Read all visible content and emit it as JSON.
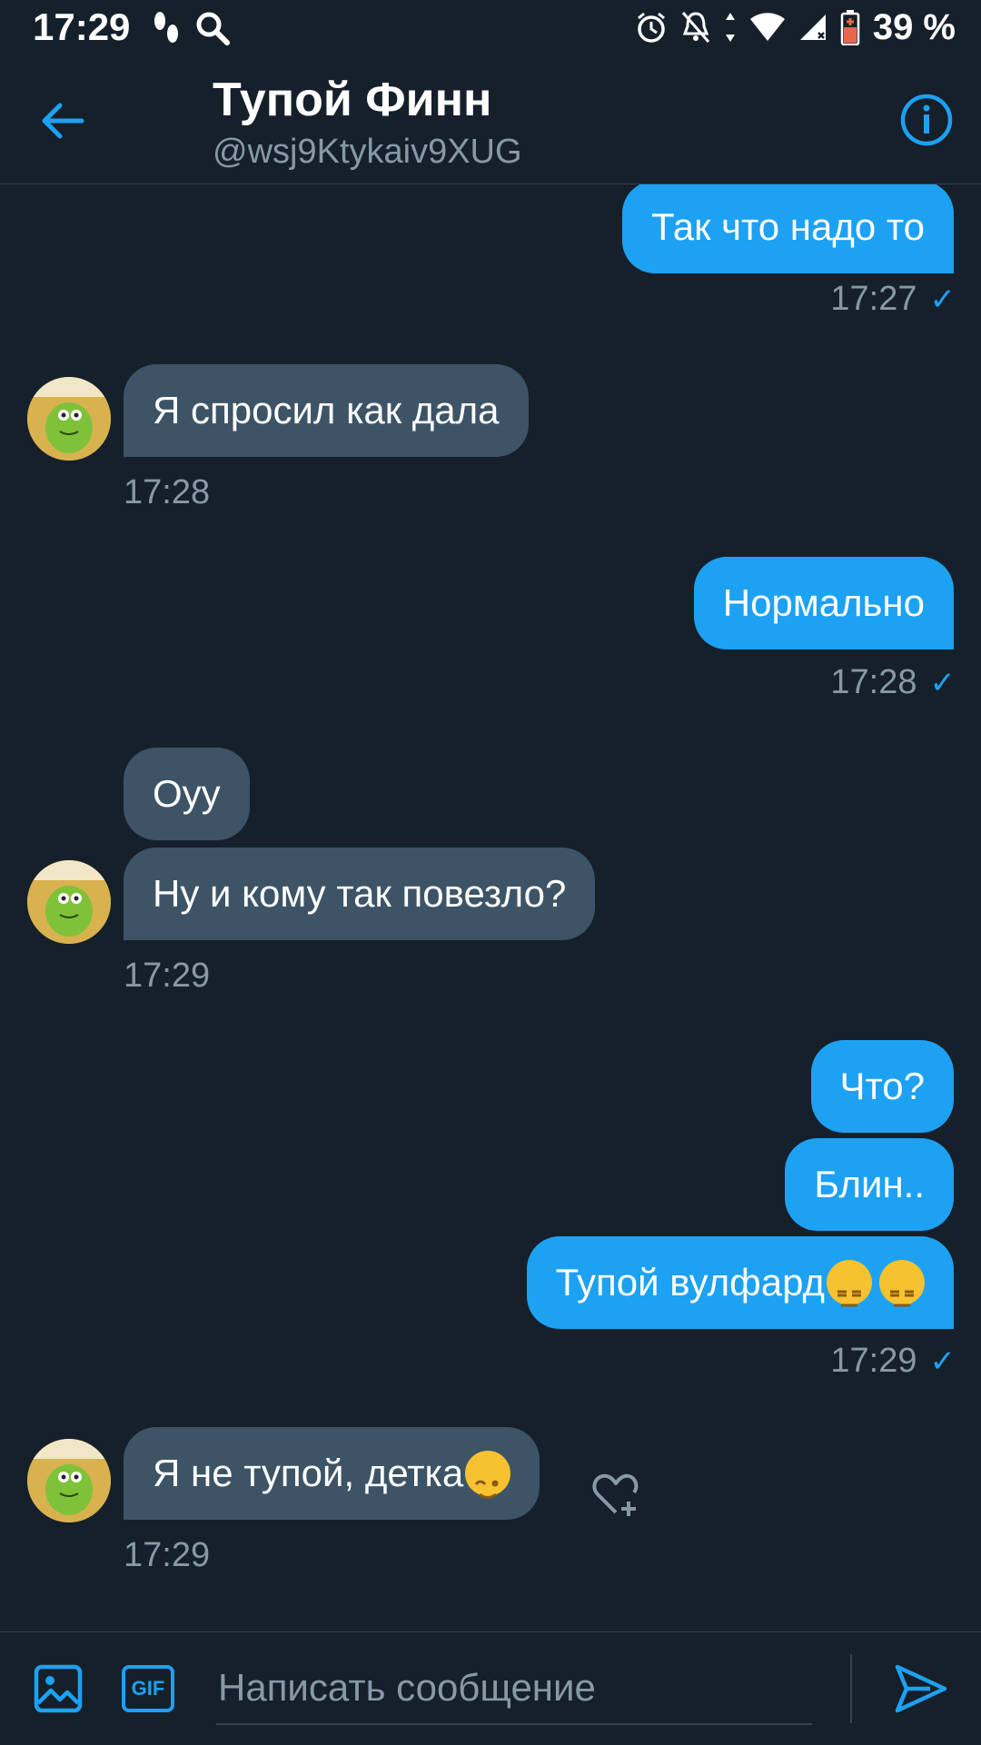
{
  "status_bar": {
    "time": "17:29",
    "battery": "39 %"
  },
  "header": {
    "contact_name": "Тупой Финн",
    "contact_handle": "@wsj9Ktykaiv9XUG"
  },
  "messages": [
    {
      "direction": "out",
      "text": "Так что надо то"
    },
    {
      "direction": "out",
      "time": "17:27"
    },
    {
      "direction": "in",
      "text": "Я спросил как дала",
      "time": "17:28"
    },
    {
      "direction": "out",
      "text": "Нормально",
      "time": "17:28"
    },
    {
      "direction": "in",
      "text": "Оуу"
    },
    {
      "direction": "in",
      "text": "Ну и кому так повезло?",
      "time": "17:29"
    },
    {
      "direction": "out",
      "text": "Что?"
    },
    {
      "direction": "out",
      "text": "Блин.."
    },
    {
      "direction": "out",
      "text": "Тупой вулфард",
      "emoji": [
        "expressionless-emoji",
        "expressionless-emoji"
      ],
      "time": "17:29"
    },
    {
      "direction": "in",
      "text": "Я не тупой, детка",
      "emoji": [
        "winking-emoji"
      ],
      "time": "17:29"
    }
  ],
  "composer": {
    "placeholder": "Написать сообщение",
    "gif_label": "GIF"
  },
  "colors": {
    "background": "#15202b",
    "accent": "#1da1f2",
    "incoming_bubble": "#3d5466",
    "secondary_text": "#8899a6"
  }
}
